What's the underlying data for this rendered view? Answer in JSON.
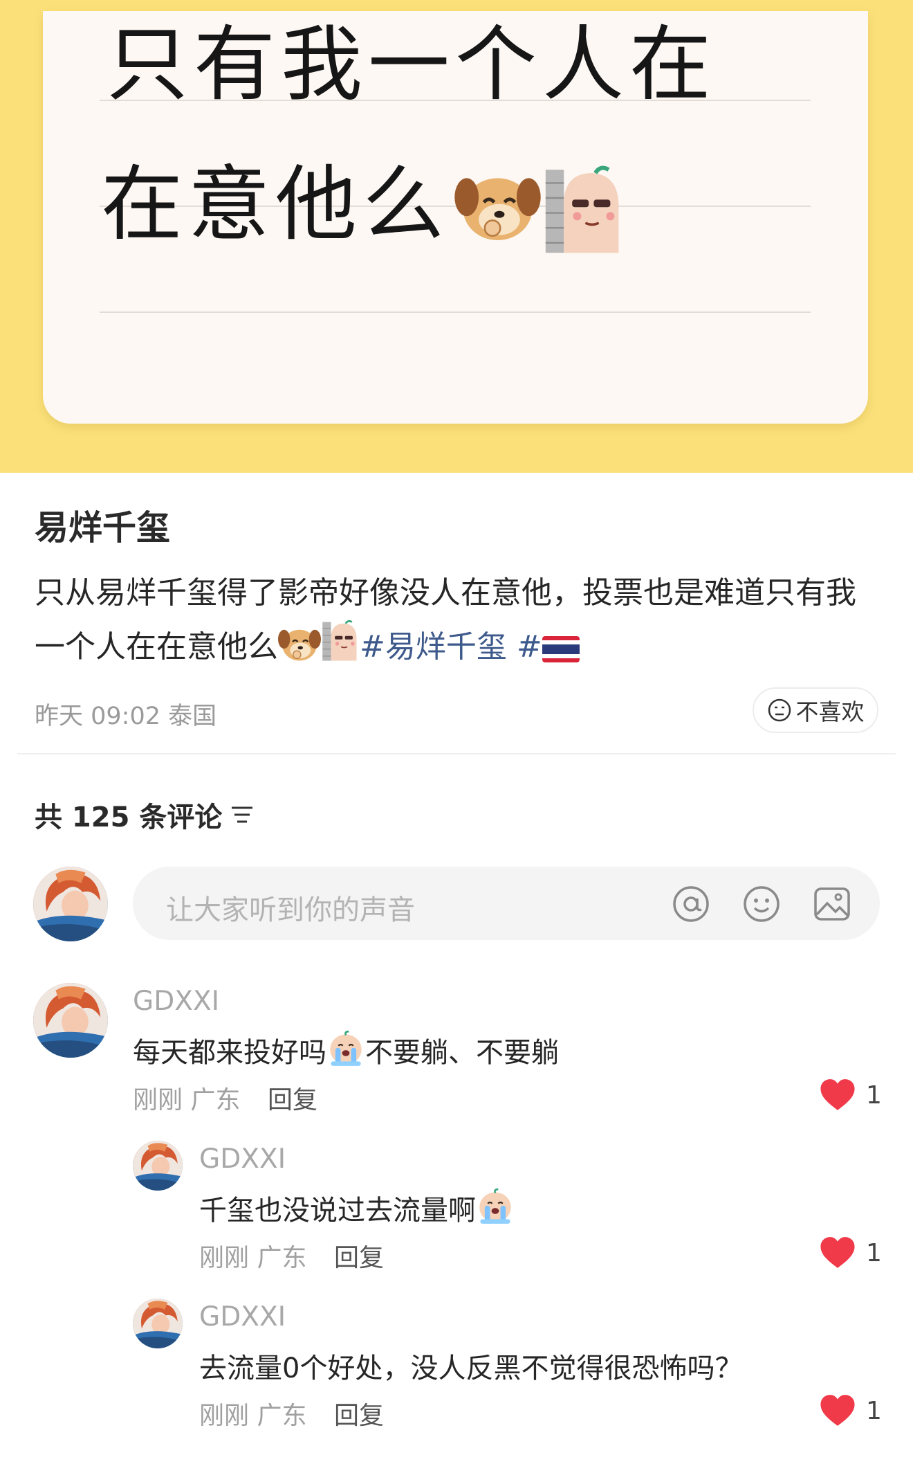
{
  "note_card": {
    "line1": "只有我一个人在",
    "line2": "在意他么"
  },
  "post": {
    "author": "易烊千玺",
    "text": "只从易烊千玺得了影帝好像没人在意他，投票也是难道只有我一个人在在意他么",
    "hashtags": [
      "#易烊千玺",
      "#"
    ],
    "flag_emoji": "thailand-flag",
    "time": "昨天 09:02",
    "location": "泰国",
    "dislike_label": "不喜欢"
  },
  "comments_header": {
    "count_label": "共 125 条评论"
  },
  "comment_input": {
    "placeholder": "让大家听到你的声音",
    "icons": [
      "at-icon",
      "emoji-icon",
      "image-icon"
    ]
  },
  "comments": [
    {
      "user": "GDXXI",
      "text_before": "每天都来投好吗",
      "text_after": "不要躺、不要躺",
      "time": "刚刚",
      "location": "广东",
      "reply_label": "回复",
      "likes": "1"
    },
    {
      "user": "GDXXI",
      "text_before": "千玺也没说过去流量啊",
      "text_after": "",
      "time": "刚刚",
      "location": "广东",
      "reply_label": "回复",
      "likes": "1"
    },
    {
      "user": "GDXXI",
      "text_before": "去流量0个好处，没人反黑不觉得很恐怖吗？",
      "text_after": "",
      "time": "刚刚",
      "location": "广东",
      "reply_label": "回复",
      "likes": "1"
    }
  ],
  "colors": {
    "banner": "#fbe07a",
    "hashtag": "#3e5a8c",
    "like_heart": "#f03a4a"
  }
}
